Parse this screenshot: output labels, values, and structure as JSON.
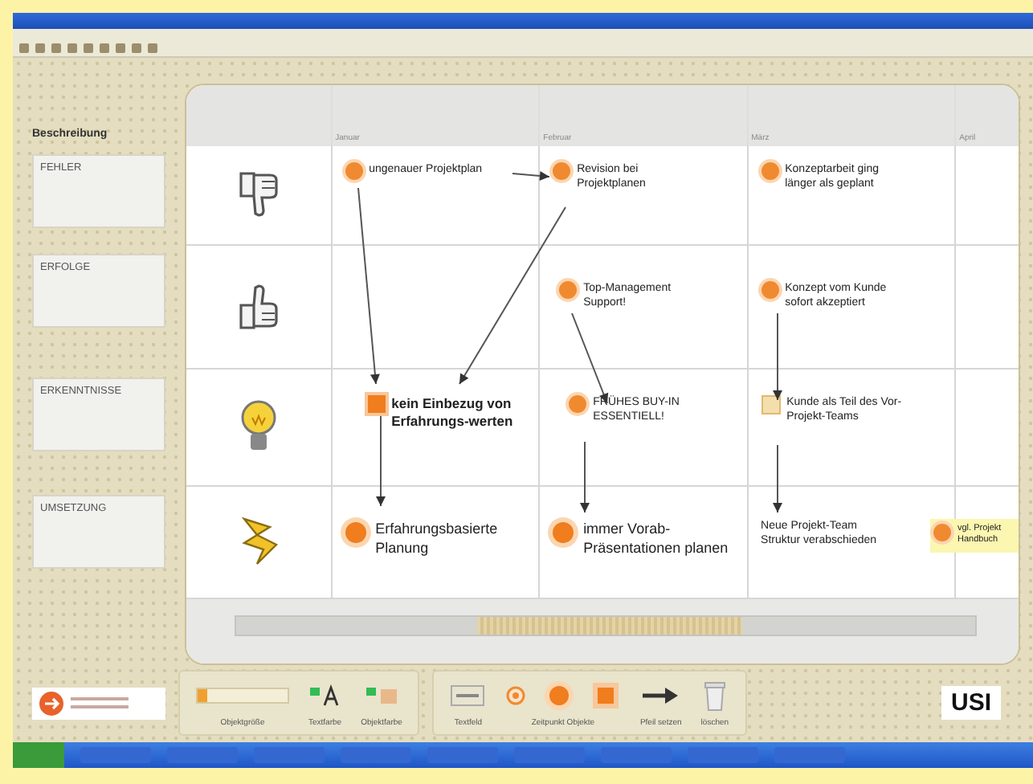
{
  "sidebar": {
    "heading": "Beschreibung",
    "categories": [
      {
        "label": "FEHLER"
      },
      {
        "label": "ERFOLGE"
      },
      {
        "label": "ERKENNTNISSE"
      },
      {
        "label": "UMSETZUNG"
      }
    ]
  },
  "timeline": {
    "columns": [
      "Januar",
      "Februar",
      "März",
      "April"
    ],
    "rows": [
      {
        "kind": "thumb-down",
        "cells": [
          [
            {
              "kind": "dot",
              "text": "ungenauer Projektplan"
            }
          ],
          [
            {
              "kind": "dot",
              "text": "Revision bei Projektplanen"
            }
          ],
          [
            {
              "kind": "dot",
              "text": "Konzeptarbeit ging länger als geplant"
            }
          ],
          []
        ]
      },
      {
        "kind": "thumb-up",
        "cells": [
          [],
          [
            {
              "kind": "dot",
              "text": "Top-Management Support!"
            }
          ],
          [
            {
              "kind": "dot",
              "text": "Konzept vom Kunde sofort akzeptiert"
            }
          ],
          []
        ]
      },
      {
        "kind": "bulb",
        "cells": [
          [
            {
              "kind": "square",
              "text": "kein Einbezug von Erfahrungs-werten"
            }
          ],
          [
            {
              "kind": "dot",
              "text": "FRÜHES BUY-IN ESSENTIELL!"
            }
          ],
          [
            {
              "kind": "pale",
              "text": "Kunde als Teil des Vor-Projekt-Teams"
            }
          ],
          []
        ]
      },
      {
        "kind": "lightning",
        "cells": [
          [
            {
              "kind": "big",
              "text": "Erfahrungsbasierte Planung"
            }
          ],
          [
            {
              "kind": "big",
              "text": "immer Vorab-Präsentationen planen"
            }
          ],
          [
            {
              "kind": "plain",
              "text": "Neue Projekt-Team Struktur verabschieden"
            }
          ],
          [
            {
              "kind": "note",
              "text": "vgl. Projekt Handbuch"
            }
          ]
        ]
      }
    ]
  },
  "toolbar": {
    "groups": [
      [
        {
          "kind": "slider",
          "level": 0.1,
          "label": "Objektgröße"
        },
        {
          "kind": "text-color",
          "label": "Textfarbe"
        },
        {
          "kind": "object-color",
          "label": "Objektfarbe"
        }
      ],
      [
        {
          "kind": "text-field",
          "label": "Textfeld"
        },
        {
          "kind": "objects",
          "label": "Zeitpunkt Objekte"
        },
        {
          "kind": "arrow",
          "label": "Pfeil setzen"
        },
        {
          "kind": "trash",
          "label": "löschen"
        }
      ]
    ]
  },
  "logo": "USI"
}
